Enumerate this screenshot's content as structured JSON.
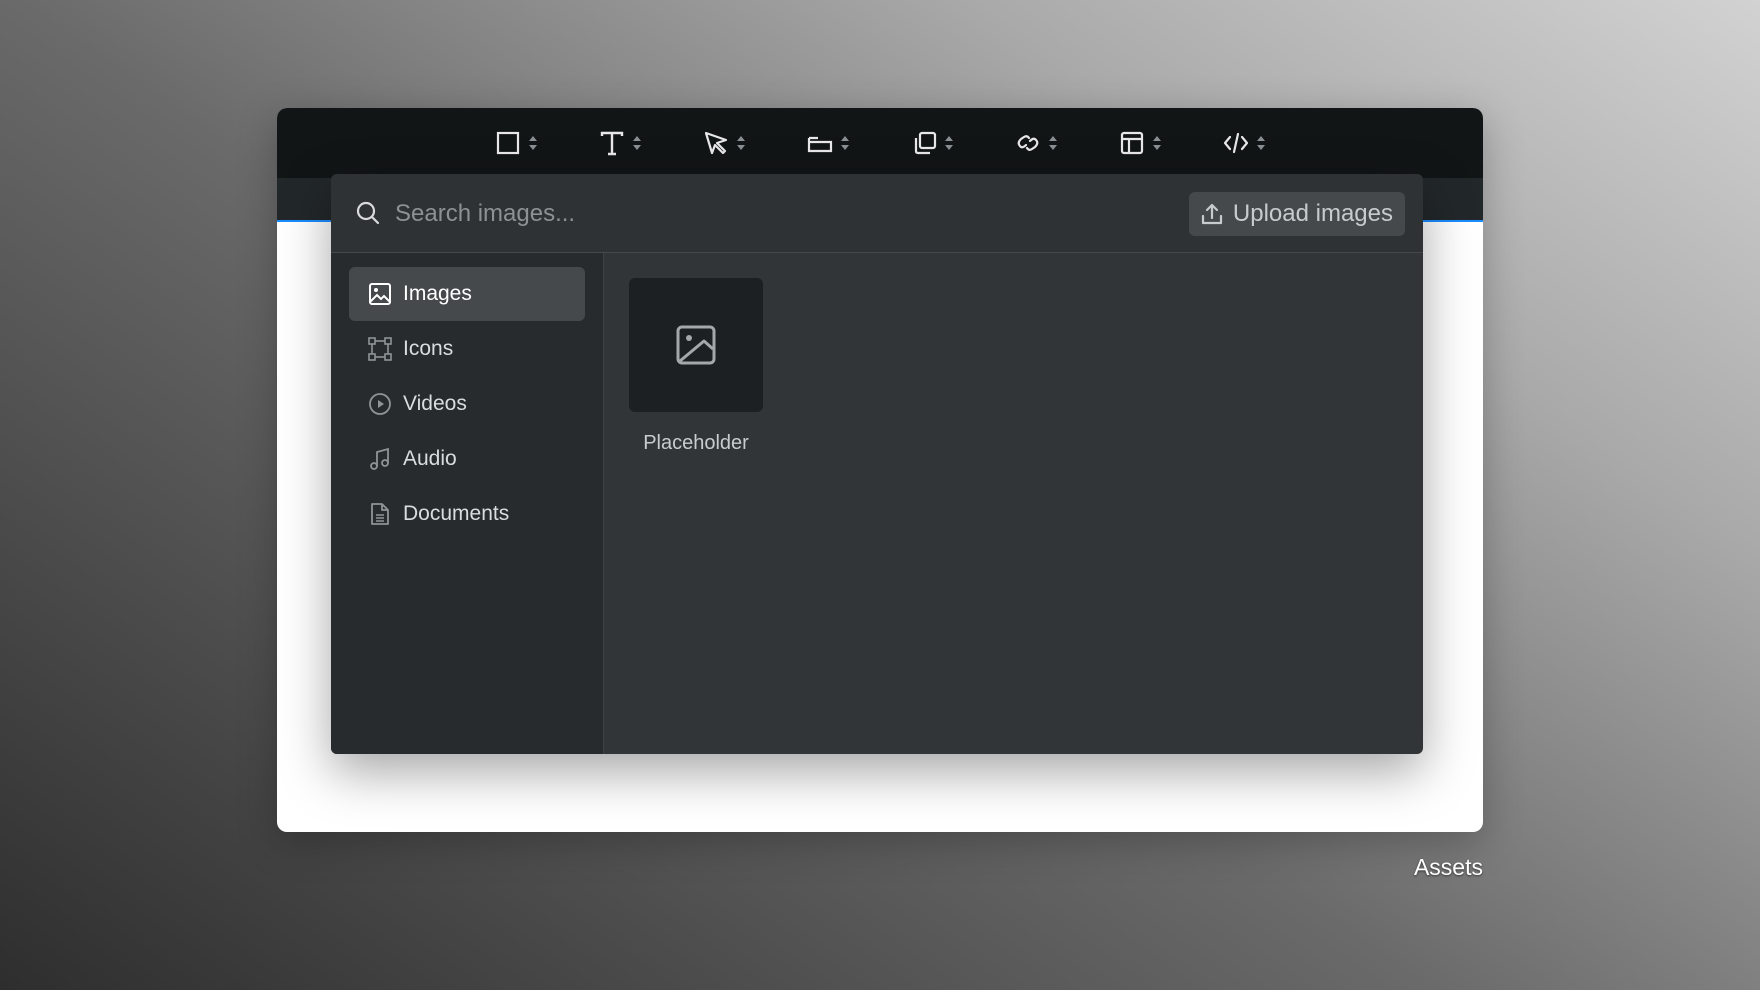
{
  "toolbar": {
    "tools": [
      {
        "name": "frame-tool",
        "icon": "square-icon"
      },
      {
        "name": "text-tool",
        "icon": "text-icon"
      },
      {
        "name": "select-tool",
        "icon": "cursor-arrow-icon"
      },
      {
        "name": "box-tool",
        "icon": "folder-tab-icon"
      },
      {
        "name": "components-tool",
        "icon": "stack-copy-icon"
      },
      {
        "name": "link-tool",
        "icon": "link-icon"
      },
      {
        "name": "layout-tool",
        "icon": "layout-icon"
      },
      {
        "name": "code-tool",
        "icon": "code-icon"
      }
    ]
  },
  "search": {
    "placeholder": "Search images...",
    "value": ""
  },
  "upload": {
    "label": "Upload images",
    "icon": "upload-icon"
  },
  "sidebar": {
    "items": [
      {
        "label": "Images",
        "icon": "image-icon",
        "active": true
      },
      {
        "label": "Icons",
        "icon": "vector-icon",
        "active": false
      },
      {
        "label": "Videos",
        "icon": "play-icon",
        "active": false
      },
      {
        "label": "Audio",
        "icon": "music-note-icon",
        "active": false
      },
      {
        "label": "Documents",
        "icon": "document-icon",
        "active": false
      }
    ]
  },
  "assets": [
    {
      "label": "Placeholder",
      "icon": "image-icon"
    }
  ],
  "caption": "Assets",
  "colors": {
    "toolbar_bg": "#121516",
    "panel_bg": "#313537",
    "sidebar_bg": "#272b2d",
    "accent": "#1a8cff"
  }
}
